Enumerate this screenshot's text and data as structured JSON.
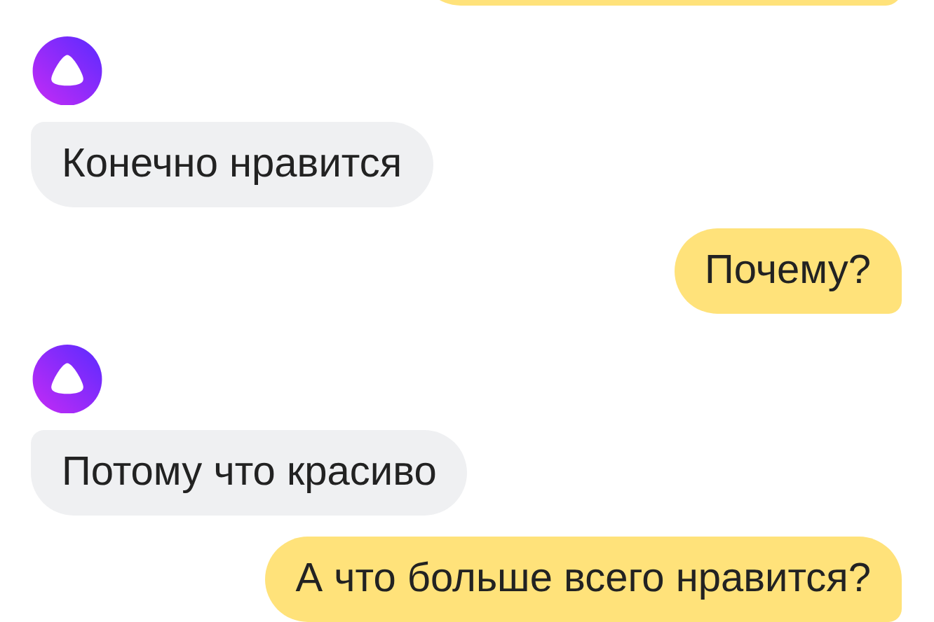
{
  "messages": [
    {
      "kind": "assistant",
      "text": "Конечно нравится"
    },
    {
      "kind": "user",
      "text": "Почему?"
    },
    {
      "kind": "assistant",
      "text": "Потому что красиво"
    },
    {
      "kind": "user",
      "text": "А что больше всего нравится?"
    }
  ]
}
